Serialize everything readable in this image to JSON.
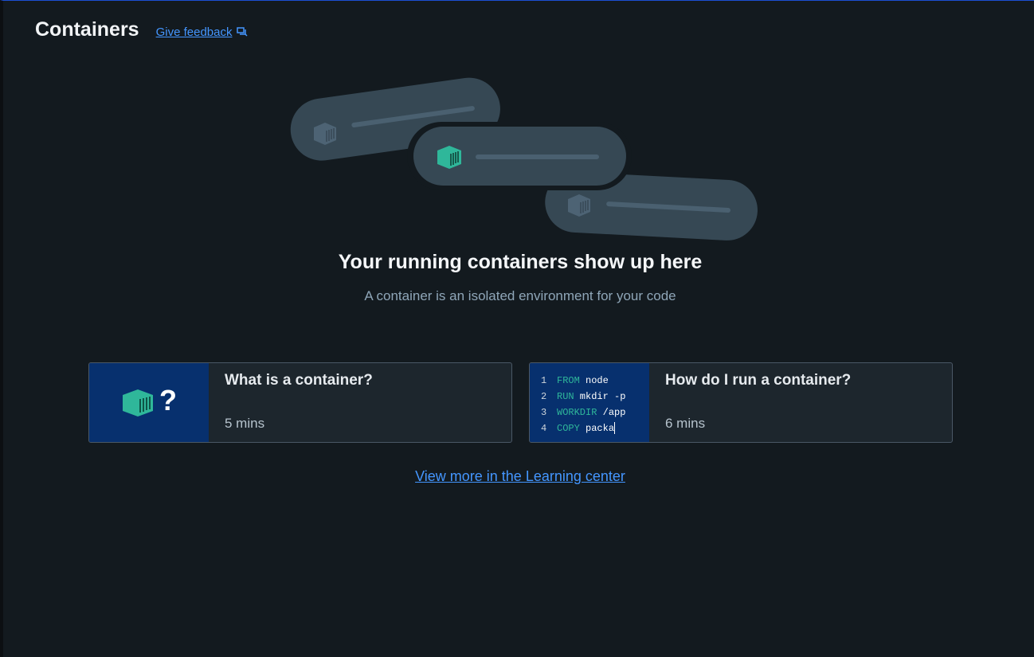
{
  "header": {
    "title": "Containers",
    "feedback_label": "Give feedback"
  },
  "hero": {
    "title": "Your running containers show up here",
    "subtitle": "A container is an isolated environment for your code"
  },
  "cards": [
    {
      "title": "What is a container?",
      "duration": "5 mins",
      "thumb_text": "?"
    },
    {
      "title": "How do I run a container?",
      "duration": "6 mins",
      "code_lines": [
        {
          "num": "1",
          "kw": "FROM",
          "rest": " node"
        },
        {
          "num": "2",
          "kw": "RUN",
          "rest": " mkdir -p"
        },
        {
          "num": "3",
          "kw": "WORKDIR",
          "rest": " /app"
        },
        {
          "num": "4",
          "kw": "COPY",
          "rest": " packa"
        }
      ]
    }
  ],
  "footer_link": "View more in the Learning center",
  "colors": {
    "background": "#131a1f",
    "accent_link": "#4496ff",
    "container_teal": "#2fb79a",
    "thumb_blue": "#07306e"
  }
}
